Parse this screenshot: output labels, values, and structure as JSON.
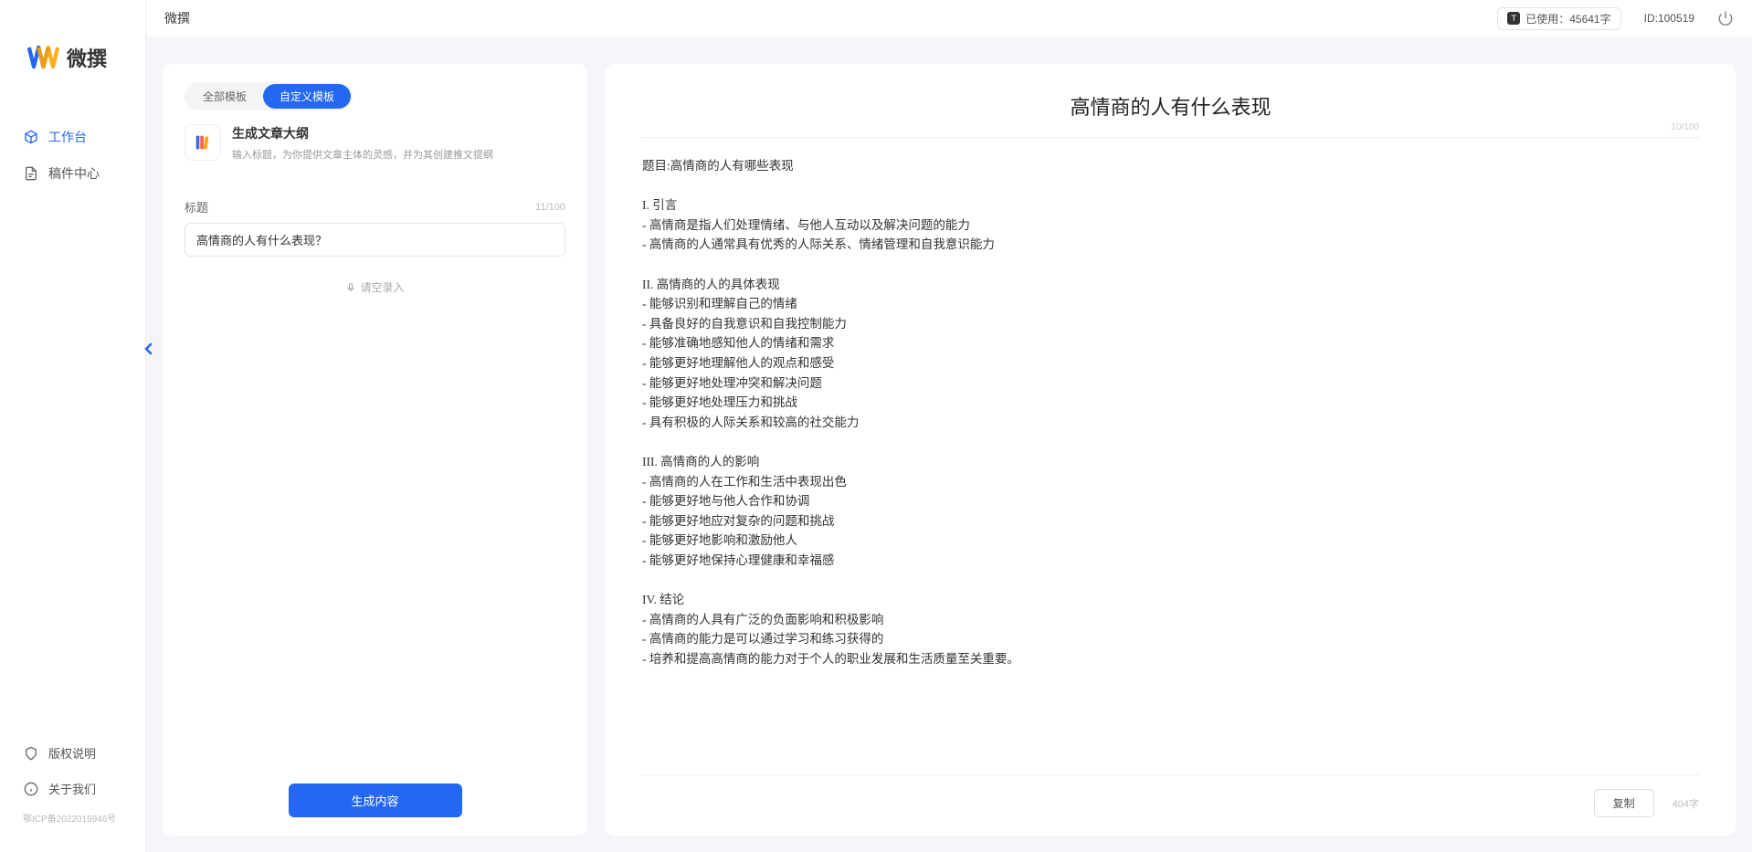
{
  "app": {
    "logo_text": "微撰",
    "header_title": "微撰"
  },
  "sidebar": {
    "nav": [
      {
        "label": "工作台",
        "active": true
      },
      {
        "label": "稿件中心",
        "active": false
      }
    ],
    "bottom": [
      {
        "label": "版权说明"
      },
      {
        "label": "关于我们"
      }
    ],
    "icp": "鄂ICP备2022016946号"
  },
  "header": {
    "usage_text": "已使用：45641字",
    "user_id": "ID:100519"
  },
  "leftPanel": {
    "tabs": [
      {
        "label": "全部模板",
        "active": false
      },
      {
        "label": "自定义模板",
        "active": true
      }
    ],
    "template": {
      "name": "生成文章大纲",
      "desc": "输入标题，为你提供文章主体的灵感，并为其创建推文提纲"
    },
    "input": {
      "label": "标题",
      "count": "11/100",
      "value": "高情商的人有什么表现？"
    },
    "voice_label": "请空录入",
    "generate_label": "生成内容"
  },
  "rightPanel": {
    "title": "高情商的人有什么表现",
    "title_count": "10/100",
    "body": "题目:高情商的人有哪些表现\n\nI. 引言\n- 高情商是指人们处理情绪、与他人互动以及解决问题的能力\n- 高情商的人通常具有优秀的人际关系、情绪管理和自我意识能力\n\nII. 高情商的人的具体表现\n- 能够识别和理解自己的情绪\n- 具备良好的自我意识和自我控制能力\n- 能够准确地感知他人的情绪和需求\n- 能够更好地理解他人的观点和感受\n- 能够更好地处理冲突和解决问题\n- 能够更好地处理压力和挑战\n- 具有积极的人际关系和较高的社交能力\n\nIII. 高情商的人的影响\n- 高情商的人在工作和生活中表现出色\n- 能够更好地与他人合作和协调\n- 能够更好地应对复杂的问题和挑战\n- 能够更好地影响和激励他人\n- 能够更好地保持心理健康和幸福感\n\nIV. 结论\n- 高情商的人具有广泛的负面影响和积极影响\n- 高情商的能力是可以通过学习和练习获得的\n- 培养和提高高情商的能力对于个人的职业发展和生活质量至关重要。",
    "copy_label": "复制",
    "word_count": "404字"
  }
}
